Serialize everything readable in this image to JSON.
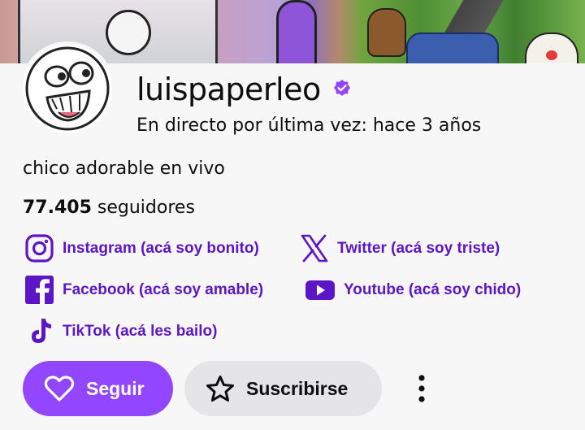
{
  "banner": {
    "icon": "channel-banner-art"
  },
  "channel": {
    "avatar_icon": "troll-face-avatar",
    "name": "luispaperleo",
    "verified_icon": "verified-badge-icon",
    "last_live": "En directo por última vez: hace 3 años",
    "bio": "chico adorable en vivo",
    "followers_count": "77.405",
    "followers_label": "seguidores"
  },
  "socials": [
    {
      "icon": "instagram-icon",
      "label": "Instagram (acá soy bonito)"
    },
    {
      "icon": "x-twitter-icon",
      "label": "Twitter (acá soy triste)"
    },
    {
      "icon": "facebook-icon",
      "label": "Facebook (acá soy amable)"
    },
    {
      "icon": "youtube-icon",
      "label": "Youtube (acá soy chido)"
    },
    {
      "icon": "tiktok-icon",
      "label": "TikTok (acá les bailo)"
    }
  ],
  "actions": {
    "follow_label": "Seguir",
    "subscribe_label": "Suscribirse",
    "more_icon": "more-vertical-icon"
  },
  "colors": {
    "accent": "#9147ff",
    "link": "#5c16c5",
    "secondary_button": "#e5e5e8",
    "background": "#f7f7f8"
  }
}
